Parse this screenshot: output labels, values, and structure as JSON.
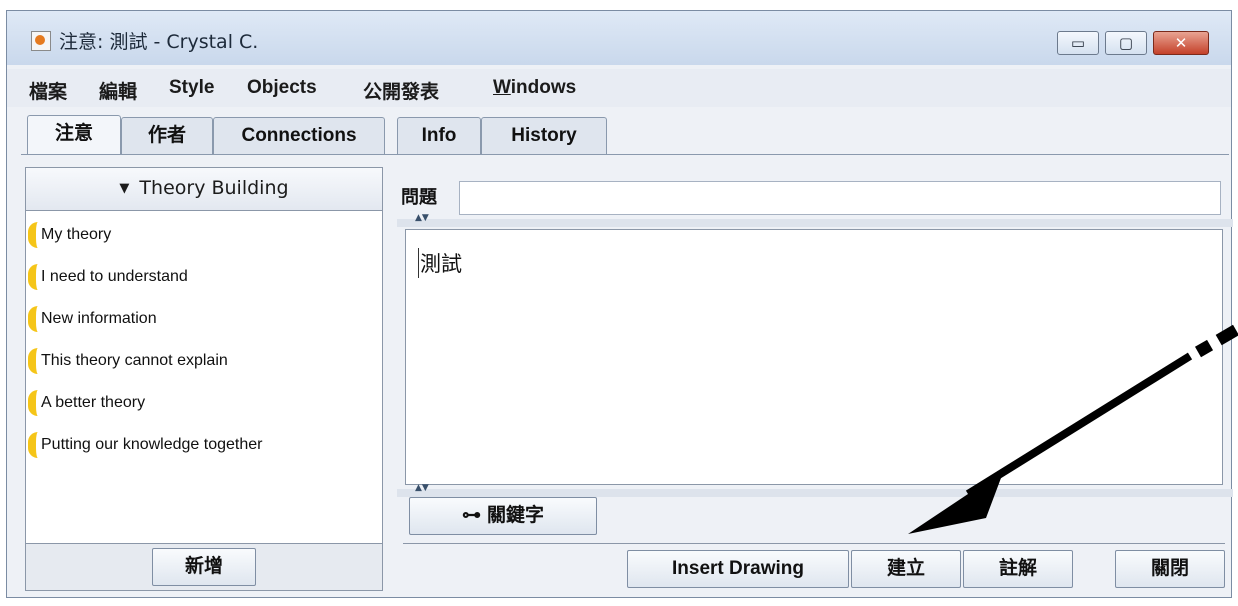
{
  "window": {
    "title": "注意: 測試 - Crystal C.",
    "controls": {
      "minimize": "▭",
      "maximize": "▢",
      "close": "✕"
    }
  },
  "menu": [
    "檔案",
    "編輯",
    "Style",
    "Objects",
    "公開發表",
    "Windows"
  ],
  "tabs": [
    "注意",
    "作者",
    "Connections",
    "Info",
    "History"
  ],
  "scaffold": {
    "header": "Theory Building",
    "arrow": "▼",
    "items": [
      "My theory",
      "I need to understand",
      "New information",
      "This theory cannot explain",
      "A better theory",
      "Putting our knowledge together"
    ],
    "add_button": "新增"
  },
  "note": {
    "problem_label": "問題",
    "problem_value": "",
    "body": "測試",
    "keywords_button": "關鍵字",
    "key_icon": "⊶"
  },
  "buttons": {
    "insert_drawing": "Insert Drawing",
    "create": "建立",
    "annotate": "註解",
    "close": "關閉"
  },
  "colors": {
    "scaffold_bracket": "#f5c518",
    "annotation_arrow": "#000000"
  }
}
